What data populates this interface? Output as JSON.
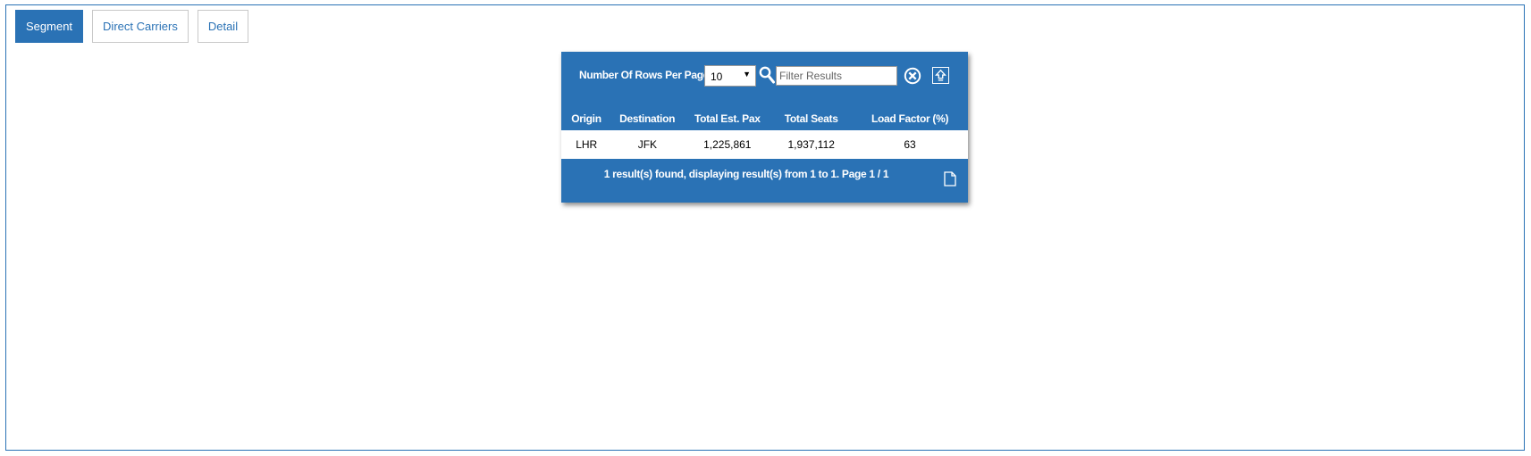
{
  "tabs": [
    {
      "label": "Segment",
      "active": true
    },
    {
      "label": "Direct Carriers",
      "active": false
    },
    {
      "label": "Detail",
      "active": false
    }
  ],
  "toolbar": {
    "rows_label": "Number Of Rows Per Page",
    "rows_value": "10",
    "filter_placeholder": "Filter Results",
    "search_icon": "search-icon",
    "clear_icon": "clear-icon",
    "export_icon": "export-up-icon"
  },
  "table": {
    "headers": [
      "Origin",
      "Destination",
      "Total Est. Pax",
      "Total Seats",
      "Load Factor (%)"
    ],
    "rows": [
      [
        "LHR",
        "JFK",
        "1,225,861",
        "1,937,112",
        "63"
      ]
    ]
  },
  "summary": "1 result(s) found, displaying result(s) from 1 to 1. Page 1 / 1",
  "footer": {
    "document_icon": "document-icon"
  },
  "colors": {
    "accent": "#2a72b5",
    "background": "#ffffff"
  }
}
